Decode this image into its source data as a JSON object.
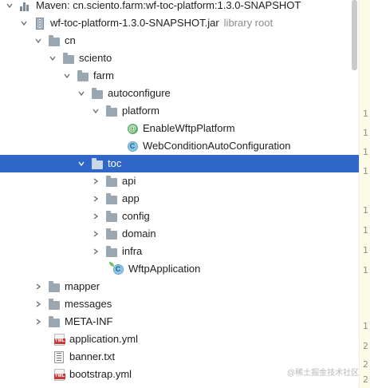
{
  "tree": {
    "rows": [
      {
        "label": "Maven: cn.sciento.farm:wf-toc-platform:1.3.0-SNAPSHOT",
        "icon": "maven-library-icon",
        "expanded": true
      },
      {
        "label": "wf-toc-platform-1.3.0-SNAPSHOT.jar",
        "hint": "library root",
        "icon": "jar-icon",
        "expanded": true
      },
      {
        "label": "cn",
        "icon": "folder-icon",
        "expanded": true
      },
      {
        "label": "sciento",
        "icon": "folder-icon",
        "expanded": true
      },
      {
        "label": "farm",
        "icon": "folder-icon",
        "expanded": true
      },
      {
        "label": "autoconfigure",
        "icon": "folder-icon",
        "expanded": true
      },
      {
        "label": "platform",
        "icon": "folder-icon",
        "expanded": true
      },
      {
        "label": "EnableWftpPlatform",
        "icon": "annotation-icon"
      },
      {
        "label": "WebConditionAutoConfiguration",
        "icon": "class-icon"
      },
      {
        "label": "toc",
        "icon": "folder-icon",
        "expanded": true,
        "selected": true
      },
      {
        "label": "api",
        "icon": "folder-icon",
        "expanded": false
      },
      {
        "label": "app",
        "icon": "folder-icon",
        "expanded": false
      },
      {
        "label": "config",
        "icon": "folder-icon",
        "expanded": false
      },
      {
        "label": "domain",
        "icon": "folder-icon",
        "expanded": false
      },
      {
        "label": "infra",
        "icon": "folder-icon",
        "expanded": false
      },
      {
        "label": "WftpApplication",
        "icon": "spring-class-icon"
      },
      {
        "label": "mapper",
        "icon": "folder-icon",
        "expanded": false
      },
      {
        "label": "messages",
        "icon": "folder-icon",
        "expanded": false
      },
      {
        "label": "META-INF",
        "icon": "folder-icon",
        "expanded": false
      },
      {
        "label": "application.yml",
        "icon": "yml-file-icon"
      },
      {
        "label": "banner.txt",
        "icon": "text-file-icon"
      },
      {
        "label": "bootstrap.yml",
        "icon": "yml-file-icon"
      }
    ]
  },
  "icons": {
    "yml_badge": "YML",
    "class_letter": "C",
    "annotation_letter": "@"
  },
  "gutter": {
    "numbers": [
      "1",
      "1",
      "1",
      "1",
      "1",
      "1",
      "1",
      "1",
      "1",
      "2",
      "2",
      "2"
    ]
  },
  "watermark": "@稀土掘金技术社区",
  "colors": {
    "selection": "#2f66c8",
    "gutter": "#fdfbe6",
    "folder": "#9aa7b0"
  }
}
